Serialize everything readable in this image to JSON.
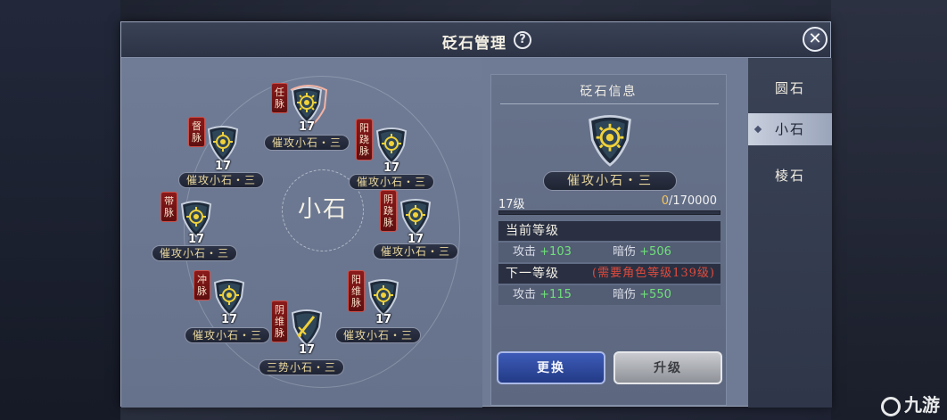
{
  "dialog": {
    "title": "砭石管理",
    "help_glyph": "?",
    "close_glyph": "✕"
  },
  "center_label": "小石",
  "slots": [
    {
      "meridian": "任脉",
      "level": "17",
      "name": "催攻小石・三",
      "gem_type": "attack"
    },
    {
      "meridian": "阳跷脉",
      "level": "17",
      "name": "催攻小石・三",
      "gem_type": "attack"
    },
    {
      "meridian": "阴跷脉",
      "level": "17",
      "name": "催攻小石・三",
      "gem_type": "attack"
    },
    {
      "meridian": "阳维脉",
      "level": "17",
      "name": "催攻小石・三",
      "gem_type": "attack"
    },
    {
      "meridian": "阴维脉",
      "level": "17",
      "name": "三势小石・三",
      "gem_type": "sword"
    },
    {
      "meridian": "冲脉",
      "level": "17",
      "name": "催攻小石・三",
      "gem_type": "attack"
    },
    {
      "meridian": "带脉",
      "level": "17",
      "name": "催攻小石・三",
      "gem_type": "attack"
    },
    {
      "meridian": "督脉",
      "level": "17",
      "name": "催攻小石・三",
      "gem_type": "attack"
    }
  ],
  "info": {
    "title": "砭石信息",
    "gem_name": "催攻小石・三",
    "level_text": "17级",
    "progress_current": "0",
    "progress_total": "/170000",
    "progress_fraction": 0.0,
    "current_head": "当前等级",
    "current_stats": {
      "stat1_label": "攻击",
      "stat1_value": "+103",
      "stat2_label": "暗伤",
      "stat2_value": "+506"
    },
    "next_head": "下一等级",
    "next_requirement": "(需要角色等级139级)",
    "next_stats": {
      "stat1_label": "攻击",
      "stat1_value": "+115",
      "stat2_label": "暗伤",
      "stat2_value": "+550"
    },
    "replace_label": "更换",
    "upgrade_label": "升级"
  },
  "tabs": [
    {
      "label": "圆石",
      "active": false
    },
    {
      "label": "小石",
      "active": true
    },
    {
      "label": "棱石",
      "active": false
    }
  ],
  "watermark": "九游",
  "colors": {
    "accent_gold": "#e9d79d",
    "stat_green": "#6fe07a",
    "requirement_red": "#e04a3c",
    "meridian_red": "#8b1a1a",
    "primary_blue": "#2d4ba6"
  }
}
